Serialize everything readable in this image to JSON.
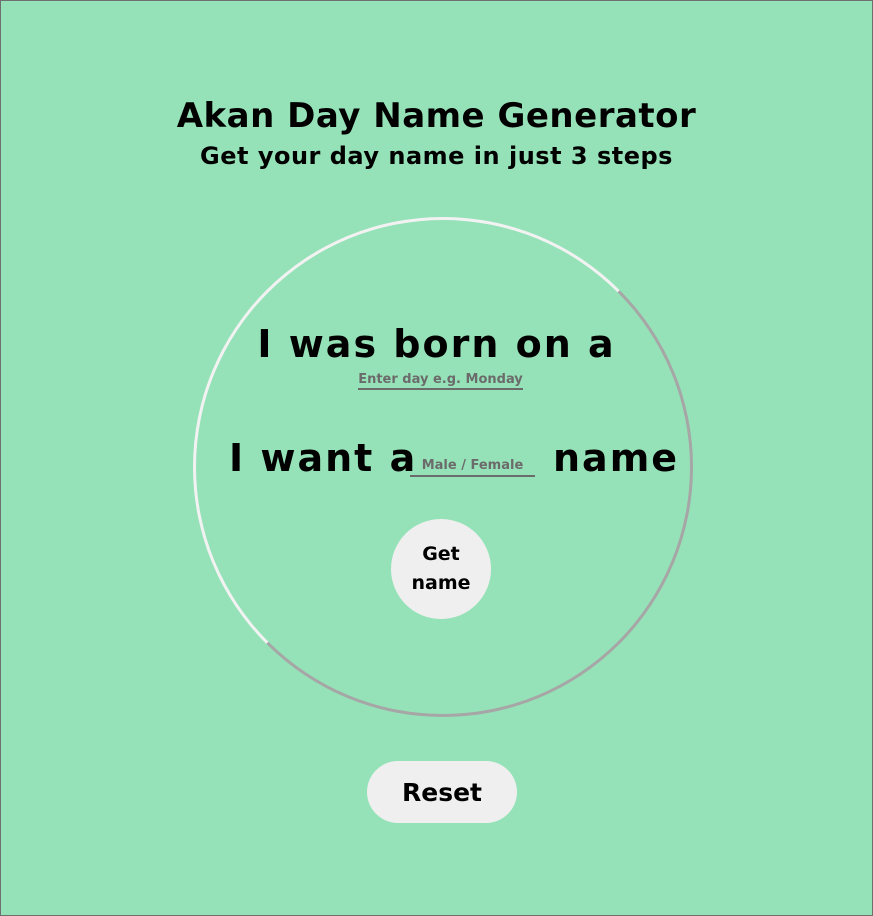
{
  "header": {
    "title": "Akan Day Name Generator",
    "subtitle": "Get your day name in just 3 steps"
  },
  "form": {
    "born_text": "I was born on a",
    "day_placeholder": "Enter day e.g. Monday",
    "want_text": "I want a",
    "gender_placeholder": "Male / Female",
    "name_text": "name",
    "get_button_label": "Get name"
  },
  "reset_label": "Reset",
  "colors": {
    "background": "#96e2b8",
    "button": "#efefef",
    "circle_border": "#a6a6a6",
    "circle_highlight": "#f2f2f2",
    "input_text": "#6b6b6b"
  }
}
